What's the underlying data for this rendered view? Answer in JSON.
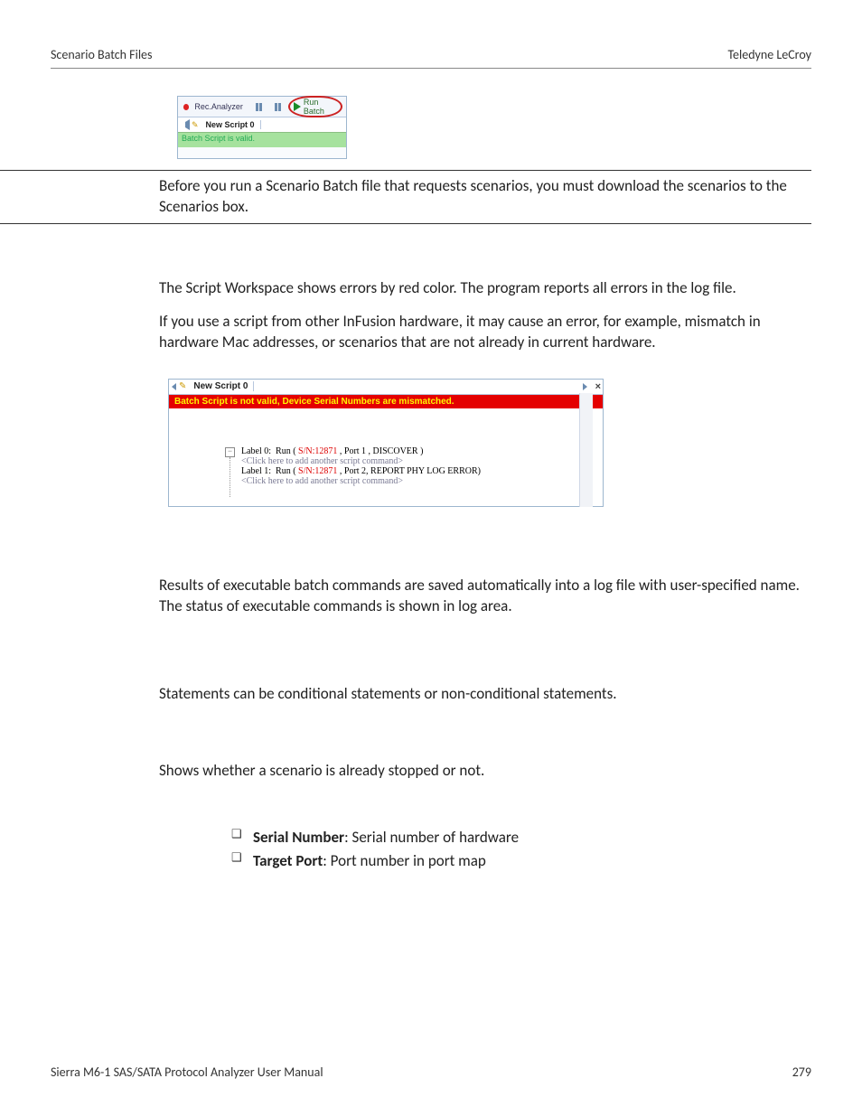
{
  "header": {
    "left": "Scenario Batch Files",
    "right": "Teledyne LeCroy"
  },
  "footer": {
    "left": "Sierra M6-1 SAS/SATA Protocol Analyzer User Manual",
    "right": "279"
  },
  "fig_toolbar": {
    "rec_label": "Rec.Analyzer",
    "run_label": "Run Batch",
    "tab_label": "New Script 0",
    "status": "Batch Script is valid."
  },
  "note": "Before you run a Scenario Batch file that requests scenarios, you must download the scenarios to the Scenarios box.",
  "para_a": "The Script Workspace shows errors by red color. The program reports all errors in the log file.",
  "para_b": "If you use a script from other InFusion hardware, it may cause an error, for example, mismatch in hardware Mac addresses, or scenarios that are not already in current hardware.",
  "fig_error": {
    "tab_label": "New Script 0",
    "close_glyph": "×",
    "error_text": "Batch Script is not valid, Device Serial Numbers are mismatched.",
    "lines": [
      {
        "label": "Label 0:",
        "pre": "Run ( ",
        "sn": "S/N:12871",
        "post": " , Port 1 , DISCOVER )"
      },
      {
        "gray": "<Click here to add another script command>"
      },
      {
        "label": "Label 1:",
        "pre": "Run ( ",
        "sn": "S/N:12871",
        "post": " , Port 2, REPORT PHY LOG ERROR)"
      },
      {
        "gray": "<Click here to add another script command>"
      }
    ]
  },
  "para_c": "Results of executable batch commands are saved automatically into a log file with user-specified name. The status of executable commands is shown in log area.",
  "para_d": "Statements can be conditional statements or non-conditional statements.",
  "para_e": "Shows whether a scenario is already stopped or not.",
  "bullets": [
    {
      "bold": "Serial Number",
      "rest": ": Serial number of hardware"
    },
    {
      "bold": "Target Port",
      "rest": ": Port number in port map"
    }
  ]
}
